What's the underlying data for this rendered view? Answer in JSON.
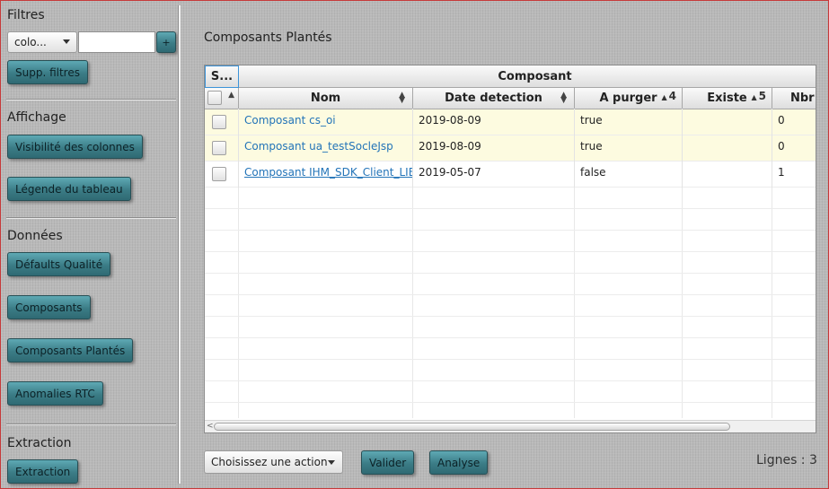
{
  "sidebar": {
    "filtres": {
      "title": "Filtres",
      "column_select": "colo...",
      "search_value": "",
      "plus_label": "+",
      "clear_label": "Supp. filtres"
    },
    "affichage": {
      "title": "Affichage",
      "buttons": [
        "Visibilité des colonnes",
        "Légende du tableau"
      ]
    },
    "donnees": {
      "title": "Données",
      "buttons": [
        "Défaults Qualité",
        "Composants",
        "Composants Plantés",
        "Anomalies RTC"
      ]
    },
    "extraction": {
      "title": "Extraction",
      "button": "Extraction"
    }
  },
  "main": {
    "title": "Composants Plantés",
    "table": {
      "select_header": "S...",
      "group_header": "Composant",
      "columns": [
        {
          "label": "Nom",
          "sort_order": ""
        },
        {
          "label": "Date detection",
          "sort_order": ""
        },
        {
          "label": "A purger",
          "sort_order": "4"
        },
        {
          "label": "Existe",
          "sort_order": "5"
        },
        {
          "label": "Nbr",
          "sort_order": ""
        }
      ],
      "rows": [
        {
          "nom": "Composant cs_oi",
          "date": "2019-08-09",
          "purger": "true",
          "existe": "",
          "nbr": "0"
        },
        {
          "nom": "Composant ua_testSocleJsp",
          "date": "2019-08-09",
          "purger": "true",
          "existe": "",
          "nbr": "0"
        },
        {
          "nom": "Composant IHM_SDK_Client_LIB",
          "date": "2019-05-07",
          "purger": "false",
          "existe": "",
          "nbr": "1"
        }
      ]
    },
    "actions": {
      "select": "Choisissez une action",
      "validate": "Valider",
      "analyse": "Analyse"
    },
    "lignes": "Lignes : 3"
  },
  "colors": {
    "button": "#3f818b",
    "row_highlight": "#fdfbe0",
    "link": "#2374b8",
    "header_focus": "#3c94d9"
  }
}
